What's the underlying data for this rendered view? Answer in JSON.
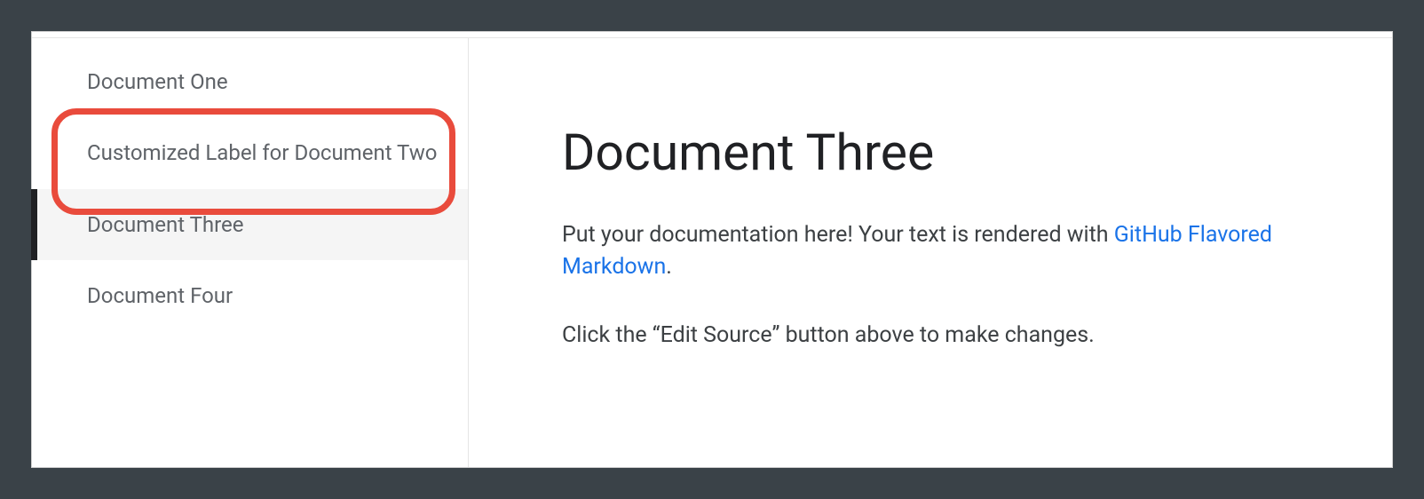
{
  "sidebar": {
    "items": [
      {
        "label": "Document One",
        "active": false
      },
      {
        "label": "Customized Label for Document Two",
        "active": false
      },
      {
        "label": "Document Three",
        "active": true
      },
      {
        "label": "Document Four",
        "active": false
      }
    ]
  },
  "content": {
    "title": "Document Three",
    "intro_text_before_link": "Put your documentation here! Your text is rendered with ",
    "link_text": "GitHub Flavored Markdown",
    "intro_text_after_link": ".",
    "instruction": "Click the “Edit Source” button above to make changes."
  }
}
